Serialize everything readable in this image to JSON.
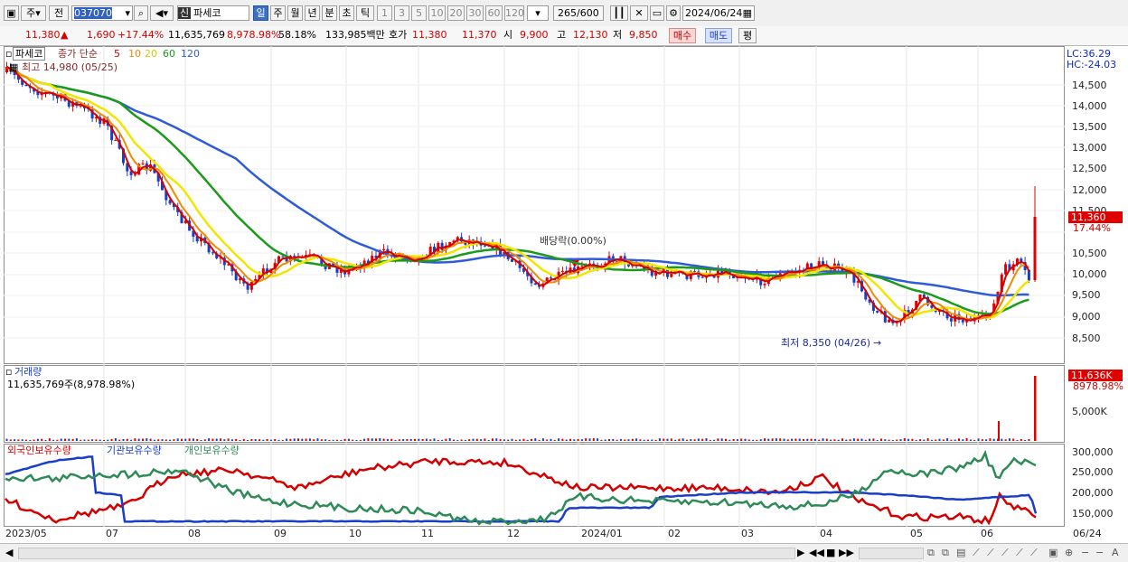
{
  "toolbar": {
    "period_week": "주",
    "prev_label": "전",
    "code": "037070",
    "stock_badge": "신",
    "stock_name": "파세코",
    "periods": [
      "일",
      "주",
      "월",
      "년",
      "분",
      "초",
      "틱"
    ],
    "numbers": [
      "1",
      "3",
      "5",
      "10",
      "20",
      "30",
      "60",
      "120"
    ],
    "count": "265",
    "count_total": "/600",
    "date": "2024/06/24"
  },
  "quote": {
    "price": "11,380",
    "arrow": "▲",
    "change": "1,690",
    "pct": "+17.44%",
    "volume": "11,635,769",
    "vol_pct": "8,978.98%",
    "rate": "58.18%",
    "amount": "133,985백만",
    "hoga_label": "호가",
    "ask": "11,380",
    "bid": "11,370",
    "open_label": "시",
    "open": "9,900",
    "high_label": "고",
    "high": "12,130",
    "low_label": "저",
    "low": "9,850",
    "buy": "매수",
    "sell": "매도",
    "eval": "평"
  },
  "price_pane": {
    "name": "파세코",
    "ma_label": "종가 단순",
    "ma_periods": [
      "5",
      "10",
      "20",
      "60",
      "120"
    ],
    "high_note": "최고 14,980 (05/25)",
    "low_note": "최저 8,350 (04/26)",
    "dividend_note": "배당락(0.00%)",
    "lc": "LC:36.29",
    "hc": "HC:-24.03",
    "last_price": "11,360",
    "last_pct": "17.44%",
    "y_ticks": [
      "14,500",
      "14,000",
      "13,500",
      "13,000",
      "12,500",
      "12,000",
      "11,500",
      "11,000",
      "10,500",
      "10,000",
      "9,500",
      "9,000",
      "8,500"
    ]
  },
  "volume_pane": {
    "title": "거래량",
    "value": "11,635,769주(8,978.98%)",
    "last": "11,636K",
    "last_pct": "8978.98%",
    "tick": "5,000K"
  },
  "holdings_pane": {
    "foreign": "외국인보유수량",
    "inst": "기관보유수량",
    "indiv": "개인보유수량",
    "ticks": [
      "300,000",
      "250,000",
      "200,000",
      "150,000"
    ]
  },
  "x_axis": [
    "2023/05",
    "07",
    "08",
    "09",
    "10",
    "11",
    "12",
    "2024/01",
    "02",
    "03",
    "04",
    "05",
    "06",
    "06/24"
  ],
  "colors": {
    "up": "#e00000",
    "down": "#1a3ec8",
    "ma5": "#d40000",
    "ma10": "#f08a00",
    "ma20": "#f2e600",
    "ma60": "#1c9a1c",
    "ma120": "#2f5bd8",
    "foreign": "#d40000",
    "inst": "#1a3ec8",
    "indiv": "#2e8b57"
  }
}
